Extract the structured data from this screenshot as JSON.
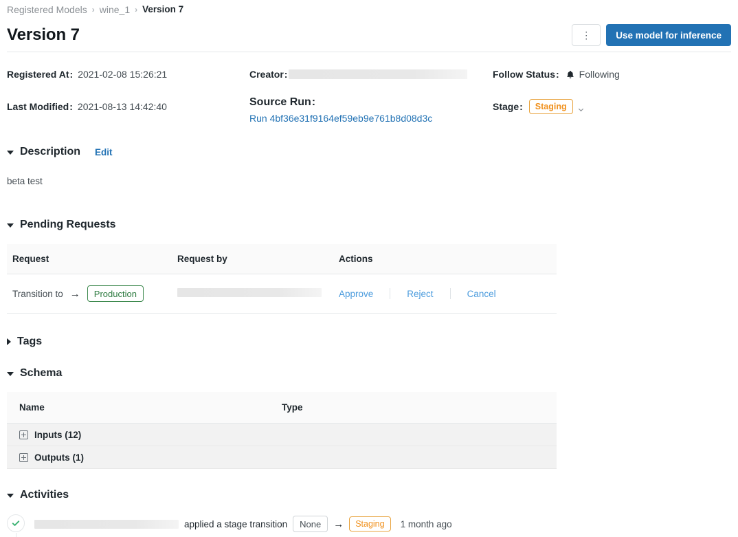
{
  "breadcrumb": {
    "items": [
      {
        "label": "Registered Models",
        "current": false
      },
      {
        "label": "wine_1",
        "current": false
      },
      {
        "label": "Version 7",
        "current": true
      }
    ],
    "separator": "›"
  },
  "header": {
    "title": "Version 7",
    "kebab_label": "⋮",
    "primary_button": "Use model for inference"
  },
  "meta": {
    "registered_at": {
      "label": "Registered At",
      "colon": ":",
      "value": "2021-02-08 15:26:21"
    },
    "last_modified": {
      "label": "Last Modified",
      "colon": ":",
      "value": "2021-08-13 14:42:40"
    },
    "creator": {
      "label": "Creator",
      "colon": ":",
      "value": ""
    },
    "source_run": {
      "label": "Source Run",
      "colon": ":",
      "link_text": "Run 4bf36e31f9164ef59eb9e761b8d08d3c"
    },
    "follow_status": {
      "label": "Follow Status",
      "colon": ":",
      "value": "Following",
      "icon": "bell-icon"
    },
    "stage": {
      "label": "Stage",
      "colon": ":",
      "value": "Staging",
      "chevron": "chevron-down-icon"
    }
  },
  "description": {
    "title": "Description",
    "edit_label": "Edit",
    "body": "beta test",
    "expanded": true
  },
  "pending_requests": {
    "title": "Pending Requests",
    "expanded": true,
    "columns": [
      "Request",
      "Request by",
      "Actions"
    ],
    "rows": [
      {
        "request_prefix": "Transition to",
        "arrow": "→",
        "target_stage": "Production",
        "requested_by": "",
        "actions": [
          "Approve",
          "Reject",
          "Cancel"
        ]
      }
    ]
  },
  "tags": {
    "title": "Tags",
    "expanded": false
  },
  "schema": {
    "title": "Schema",
    "expanded": true,
    "columns": [
      "Name",
      "Type"
    ],
    "rows": [
      {
        "name": "Inputs (12)",
        "type": "",
        "expand_icon": "plus-box-icon"
      },
      {
        "name": "Outputs (1)",
        "type": "",
        "expand_icon": "plus-box-icon"
      }
    ]
  },
  "activities": {
    "title": "Activities",
    "expanded": true,
    "entries": [
      {
        "status_icon": "check-circle-icon",
        "actor": "",
        "text": "applied a stage transition",
        "from_stage": "None",
        "arrow": "→",
        "to_stage": "Staging",
        "time": "1 month ago"
      }
    ]
  },
  "colors": {
    "primary": "#2272b4",
    "link": "#2272b4",
    "action_link": "#4a9bdd",
    "staging": "#f0911e",
    "production": "#2c7a3f",
    "success": "#3bb273",
    "border": "#e4e7e9",
    "header_bg": "#fafafa",
    "schema_row_bg": "#f2f2f2"
  }
}
